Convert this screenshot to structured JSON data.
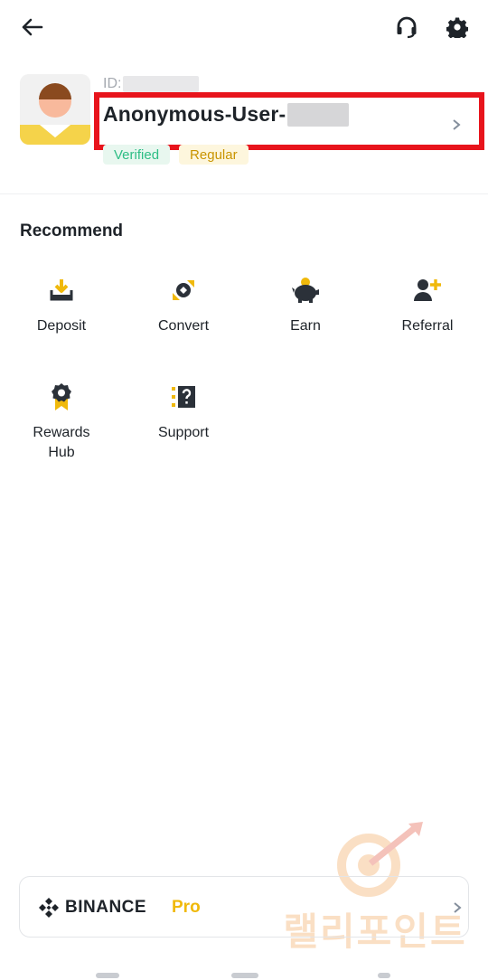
{
  "header": {
    "back_icon": "arrow-left-icon",
    "support_icon": "headset-icon",
    "settings_icon": "gear-icon"
  },
  "profile": {
    "id_label": "ID:",
    "name": "Anonymous-User-",
    "badges": [
      "Verified",
      "Regular"
    ]
  },
  "recommend": {
    "title": "Recommend",
    "items": [
      {
        "label": "Deposit",
        "icon": "deposit-icon"
      },
      {
        "label": "Convert",
        "icon": "convert-icon"
      },
      {
        "label": "Earn",
        "icon": "piggy-bank-icon"
      },
      {
        "label": "Referral",
        "icon": "add-user-icon"
      },
      {
        "label": "Rewards Hub",
        "icon": "rewards-badge-icon"
      },
      {
        "label": "Support",
        "icon": "support-question-icon"
      }
    ]
  },
  "pro_banner": {
    "brand": "BINANCE",
    "suffix": "Pro"
  },
  "watermark": {
    "text": "랠리포인트"
  },
  "colors": {
    "accent": "#F0B90B",
    "highlight_box": "#E8141C",
    "verified": "#2EBD85",
    "regular": "#C99400"
  }
}
